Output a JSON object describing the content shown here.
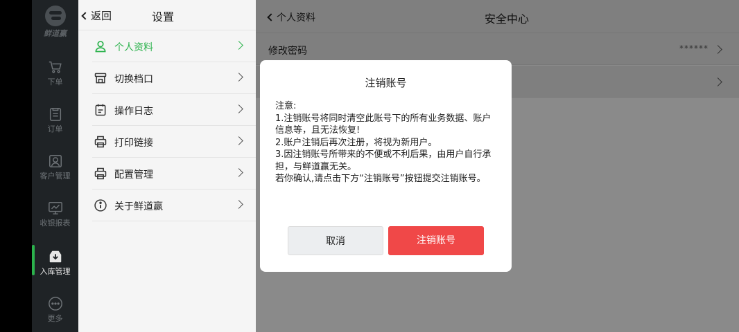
{
  "rail": {
    "brand": "鲜道赢",
    "items": [
      {
        "label": "下单",
        "icon": "cart-icon"
      },
      {
        "label": "订单",
        "icon": "order-icon"
      },
      {
        "label": "客户管理",
        "icon": "customer-icon"
      },
      {
        "label": "收银报表",
        "icon": "report-icon"
      },
      {
        "label": "入库管理",
        "icon": "inbound-icon",
        "active": true
      },
      {
        "label": "更多",
        "icon": "more-icon"
      }
    ]
  },
  "settings": {
    "back_label": "返回",
    "title": "设置",
    "items": [
      {
        "label": "个人资料",
        "icon": "user-icon",
        "active": true
      },
      {
        "label": "切换档口",
        "icon": "store-icon"
      },
      {
        "label": "操作日志",
        "icon": "log-icon"
      },
      {
        "label": "打印链接",
        "icon": "printer-icon"
      },
      {
        "label": "配置管理",
        "icon": "printer-icon"
      },
      {
        "label": "关于鲜道赢",
        "icon": "info-icon"
      }
    ]
  },
  "panel": {
    "back_label": "个人资料",
    "title": "安全中心",
    "rows": [
      {
        "label": "修改密码",
        "value": "******"
      },
      {
        "label": "",
        "value": ""
      }
    ]
  },
  "dialog": {
    "title": "注销账号",
    "lines": [
      "注意:",
      "1.注销账号将同时清空此账号下的所有业务数据、账户信息等，且无法恢复!",
      "2.账户注销后再次注册，将视为新用户。",
      "3.因注销账号所带来的不便或不利后果，由用户自行承担，与鲜道赢无关。",
      "若你确认,请点击下方“注销账号”按钮提交注销账号。"
    ],
    "cancel_label": "取消",
    "confirm_label": "注销账号"
  },
  "colors": {
    "accent": "#2bb24c",
    "danger": "#f04848",
    "rail_bg": "#1f2326"
  }
}
